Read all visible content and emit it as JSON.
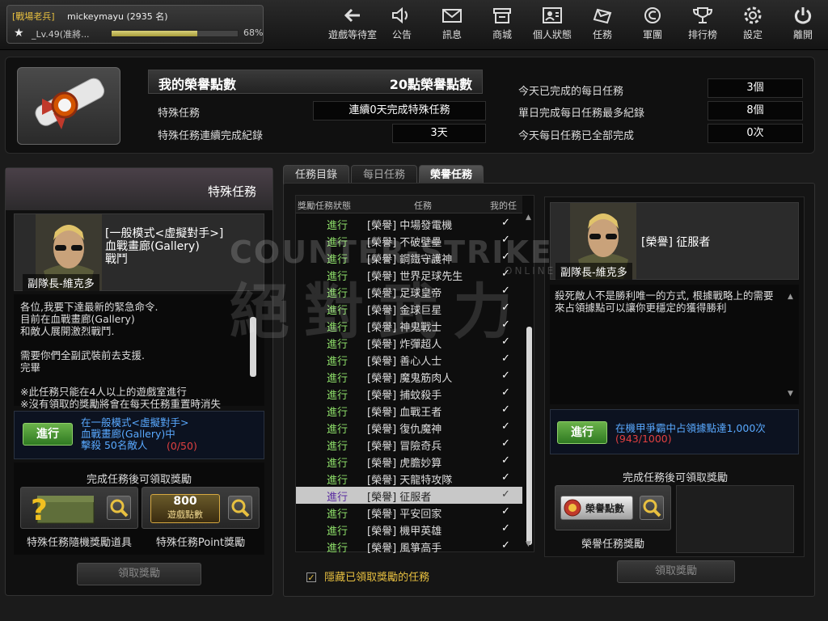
{
  "player": {
    "rank": "[戰場老兵]",
    "name": "mickeymayu (2935 名)",
    "level_text": "_Lv.49(准將...",
    "exp_fraction": 0.68,
    "exp_percent": "68%"
  },
  "nav": [
    {
      "label": "遊戲等待室",
      "icon": "back-arrow-icon"
    },
    {
      "label": "公告",
      "icon": "speaker-icon"
    },
    {
      "label": "訊息",
      "icon": "mail-icon"
    },
    {
      "label": "商城",
      "icon": "shop-icon"
    },
    {
      "label": "個人狀態",
      "icon": "profile-card-icon"
    },
    {
      "label": "任務",
      "icon": "mission-icon"
    },
    {
      "label": "軍團",
      "icon": "clan-icon"
    },
    {
      "label": "排行榜",
      "icon": "trophy-icon"
    },
    {
      "label": "設定",
      "icon": "gear-icon"
    },
    {
      "label": "離開",
      "icon": "power-icon"
    }
  ],
  "header": {
    "title": "我的榮譽點數",
    "points": "20點榮譽點數",
    "special_label": "特殊任務",
    "special_value": "連續0天完成特殊任務",
    "record_label": "特殊任務連續完成紀錄",
    "record_value": "3天",
    "today_label": "今天已完成的每日任務",
    "today_value": "3個",
    "max_label": "單日完成每日任務最多紀錄",
    "max_value": "8個",
    "all_label": "今天每日任務已全部完成",
    "all_value": "0次"
  },
  "left": {
    "panel_title": "特殊任務",
    "mission_title": "[一般模式<虛擬對手>]\n血戰畫廊(Gallery)\n戰鬥",
    "npc": "副隊長-維克多",
    "description": "各位,我要下達最新的緊急命令.\n目前在血戰畫廊(Gallery)\n和敵人展開激烈戰鬥.\n\n需要你們全副武裝前去支援.\n完畢\n\n※此任務只能在4人以上的遊戲室進行\n※沒有領取的獎勵將會在每天任務重置時消失",
    "status_btn": "進行",
    "objective": "在一般模式<虛擬對手>\n血戰畫廊(Gallery)中\n擊殺 50名敵人",
    "progress": "(0/50)",
    "reward_title": "完成任務後可領取獎勵",
    "reward1": "特殊任務隨機獎勵道具",
    "reward2": "特殊任務Point獎勵",
    "reward2_amount": "800",
    "reward2_sub": "遊戲點數",
    "claim": "領取獎勵"
  },
  "tabs": [
    "任務目錄",
    "每日任務",
    "榮譽任務"
  ],
  "list": {
    "col_status": "獎勵任務狀態",
    "col_name": "任務",
    "col_mine": "我的任",
    "rows": [
      {
        "status": "進行",
        "name": "[榮譽] 中場發電機"
      },
      {
        "status": "進行",
        "name": "[榮譽] 不破壁壘"
      },
      {
        "status": "進行",
        "name": "[榮譽] 鋼鐵守護神"
      },
      {
        "status": "進行",
        "name": "[榮譽] 世界足球先生"
      },
      {
        "status": "進行",
        "name": "[榮譽] 足球皇帝"
      },
      {
        "status": "進行",
        "name": "[榮譽] 金球巨星"
      },
      {
        "status": "進行",
        "name": "[榮譽] 神鬼戰士"
      },
      {
        "status": "進行",
        "name": "[榮譽] 炸彈超人"
      },
      {
        "status": "進行",
        "name": "[榮譽] 善心人士"
      },
      {
        "status": "進行",
        "name": "[榮譽] 魔鬼筋肉人"
      },
      {
        "status": "進行",
        "name": "[榮譽] 捕蚊殺手"
      },
      {
        "status": "進行",
        "name": "[榮譽] 血戰王者"
      },
      {
        "status": "進行",
        "name": "[榮譽] 復仇魔神"
      },
      {
        "status": "進行",
        "name": "[榮譽] 冒險奇兵"
      },
      {
        "status": "進行",
        "name": "[榮譽] 虎膽妙算"
      },
      {
        "status": "進行",
        "name": "[榮譽] 天龍特攻隊"
      },
      {
        "status": "進行",
        "name": "[榮譽] 征服者",
        "selected": true
      },
      {
        "status": "進行",
        "name": "[榮譽] 平安回家"
      },
      {
        "status": "進行",
        "name": "[榮譽] 機甲英雄"
      },
      {
        "status": "進行",
        "name": "[榮譽] 風箏高手"
      }
    ],
    "hide_label": "隱藏已領取獎勵的任務"
  },
  "right": {
    "mission_title": "[榮譽] 征服者",
    "npc": "副隊長-維克多",
    "description": "殺死敵人不是勝利唯一的方式, 根據戰略上的需要來占領據點可以讓你更穩定的獲得勝利",
    "status_btn": "進行",
    "objective": "在機甲爭霸中占領據點達1,000次",
    "progress": "(943/1000)",
    "reward_title": "完成任務後可領取獎勵",
    "reward_badge": "榮譽點數",
    "reward_label": "榮譽任務獎勵",
    "claim": "領取獎勵"
  },
  "watermark": {
    "line1": "COUNTER-STRIKE",
    "line2": "ONLINE",
    "cjk": "絕對武力"
  }
}
